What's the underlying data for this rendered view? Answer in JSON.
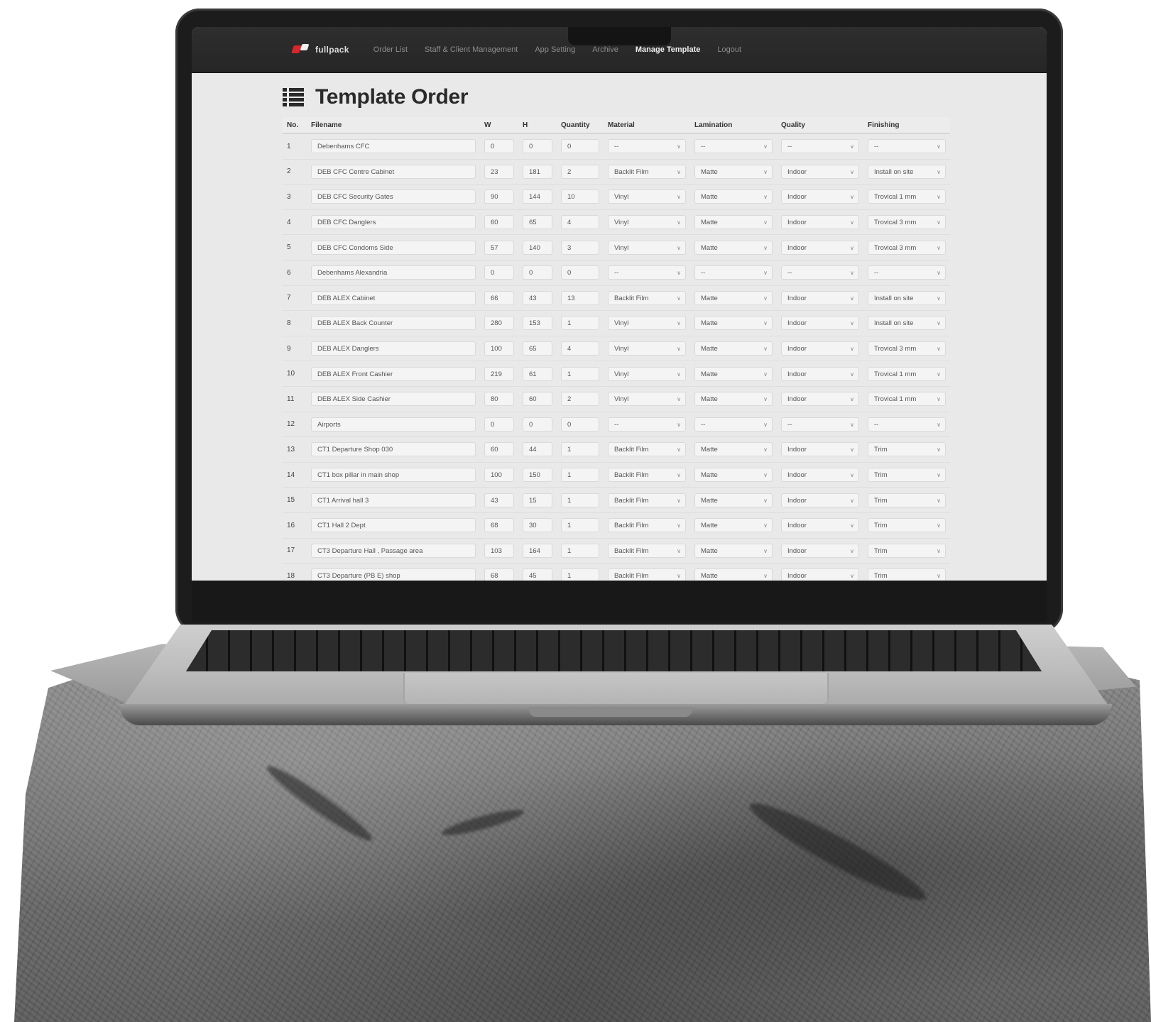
{
  "nav": {
    "brand": "fullpack",
    "links": [
      {
        "label": "Order List",
        "active": false
      },
      {
        "label": "Staff & Client Management",
        "active": false
      },
      {
        "label": "App Setting",
        "active": false
      },
      {
        "label": "Archive",
        "active": false
      },
      {
        "label": "Manage Template",
        "active": true
      },
      {
        "label": "Logout",
        "active": false
      }
    ]
  },
  "page": {
    "title": "Template Order"
  },
  "table": {
    "headers": [
      "No.",
      "Filename",
      "W",
      "H",
      "Quantity",
      "Material",
      "Lamination",
      "Quality",
      "Finishing"
    ],
    "rows": [
      [
        "1",
        "Debenhams CFC",
        "0",
        "0",
        "0",
        "--",
        "--",
        "--",
        "--"
      ],
      [
        "2",
        "DEB CFC Centre Cabinet",
        "23",
        "181",
        "2",
        "Backlit Film",
        "Matte",
        "Indoor",
        "Install on site"
      ],
      [
        "3",
        "DEB CFC Security Gates",
        "90",
        "144",
        "10",
        "Vinyl",
        "Matte",
        "Indoor",
        "Trovical 1 mm"
      ],
      [
        "4",
        "DEB CFC Danglers",
        "60",
        "65",
        "4",
        "Vinyl",
        "Matte",
        "Indoor",
        "Trovical 3 mm"
      ],
      [
        "5",
        "DEB CFC Condoms Side",
        "57",
        "140",
        "3",
        "Vinyl",
        "Matte",
        "Indoor",
        "Trovical 3 mm"
      ],
      [
        "6",
        "Debenhams Alexandria",
        "0",
        "0",
        "0",
        "--",
        "--",
        "--",
        "--"
      ],
      [
        "7",
        "DEB ALEX Cabinet",
        "66",
        "43",
        "13",
        "Backlit Film",
        "Matte",
        "Indoor",
        "Install on site"
      ],
      [
        "8",
        "DEB ALEX Back Counter",
        "280",
        "153",
        "1",
        "Vinyl",
        "Matte",
        "Indoor",
        "Install on site"
      ],
      [
        "9",
        "DEB ALEX Danglers",
        "100",
        "65",
        "4",
        "Vinyl",
        "Matte",
        "Indoor",
        "Trovical 3 mm"
      ],
      [
        "10",
        "DEB ALEX Front Cashier",
        "219",
        "61",
        "1",
        "Vinyl",
        "Matte",
        "Indoor",
        "Trovical 1 mm"
      ],
      [
        "11",
        "DEB ALEX Side Cashier",
        "80",
        "60",
        "2",
        "Vinyl",
        "Matte",
        "Indoor",
        "Trovical 1 mm"
      ],
      [
        "12",
        "Airports",
        "0",
        "0",
        "0",
        "--",
        "--",
        "--",
        "--"
      ],
      [
        "13",
        "CT1 Departure Shop 030",
        "60",
        "44",
        "1",
        "Backlit Film",
        "Matte",
        "Indoor",
        "Trim"
      ],
      [
        "14",
        "CT1 box pillar in main shop",
        "100",
        "150",
        "1",
        "Backlit Film",
        "Matte",
        "Indoor",
        "Trim"
      ],
      [
        "15",
        "CT1 Arrival hall 3",
        "43",
        "15",
        "1",
        "Backlit Film",
        "Matte",
        "Indoor",
        "Trim"
      ],
      [
        "16",
        "CT1 Hall 2 Dept",
        "68",
        "30",
        "1",
        "Backlit Film",
        "Matte",
        "Indoor",
        "Trim"
      ],
      [
        "17",
        "CT3 Departure Hall , Passage area",
        "103",
        "164",
        "1",
        "Backlit Film",
        "Matte",
        "Indoor",
        "Trim"
      ],
      [
        "18",
        "CT3 Departure (PB E) shop",
        "68",
        "45",
        "1",
        "Backlit Film",
        "Matte",
        "Indoor",
        "Trim"
      ]
    ]
  },
  "colors": {
    "navbar": "#2a2a2a",
    "brand_red": "#d7262c",
    "screen_bg": "#e9e9e9"
  }
}
